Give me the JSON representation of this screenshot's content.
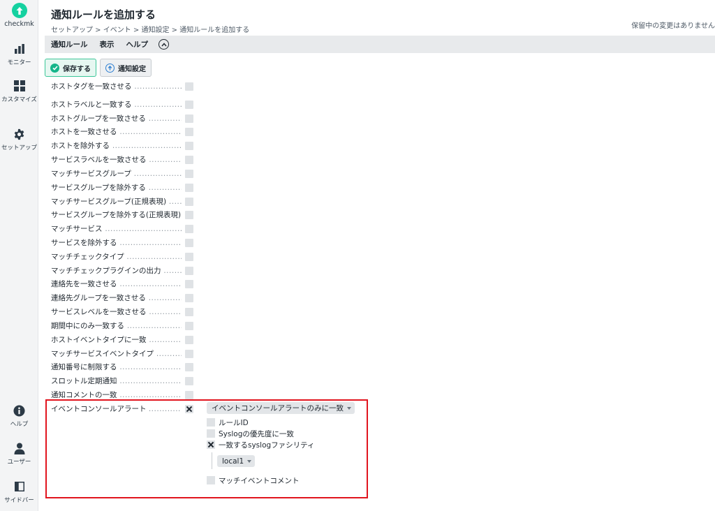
{
  "sidebar": {
    "logo_text": "checkmk",
    "top_items": [
      {
        "label": "モニター",
        "icon": "bar-chart-icon"
      },
      {
        "label": "カスタマイズ",
        "icon": "grid-icon"
      },
      {
        "label": "セットアップ",
        "icon": "gear-icon"
      }
    ],
    "bottom_items": [
      {
        "label": "ヘルプ",
        "icon": "info-icon"
      },
      {
        "label": "ユーザー",
        "icon": "user-icon"
      },
      {
        "label": "サイドバー",
        "icon": "sidebar-toggle-icon"
      }
    ]
  },
  "header": {
    "title": "通知ルールを追加する",
    "breadcrumb": "セットアップ > イベント > 通知設定 > 通知ルールを追加する",
    "pending_changes": "保留中の変更はありません"
  },
  "menubar": {
    "items": [
      "通知ルール",
      "表示",
      "ヘルプ"
    ]
  },
  "toolbar": {
    "save_label": "保存する",
    "settings_label": "通知設定"
  },
  "form": {
    "rows": [
      {
        "label": "ホストタグを一致させる",
        "checked": false
      },
      {
        "label": "ホストラベルと一致する",
        "checked": false
      },
      {
        "label": "ホストグループを一致させる",
        "checked": false
      },
      {
        "label": "ホストを一致させる",
        "checked": false
      },
      {
        "label": "ホストを除外する",
        "checked": false
      },
      {
        "label": "サービスラベルを一致させる",
        "checked": false
      },
      {
        "label": "マッチサービスグループ",
        "checked": false
      },
      {
        "label": "サービスグループを除外する",
        "checked": false
      },
      {
        "label": "マッチサービスグループ(正規表現)",
        "checked": false
      },
      {
        "label": "サービスグループを除外する(正規表現)",
        "checked": false
      },
      {
        "label": "マッチサービス",
        "checked": false
      },
      {
        "label": "サービスを除外する",
        "checked": false
      },
      {
        "label": "マッチチェックタイプ",
        "checked": false
      },
      {
        "label": "マッチチェックプラグインの出力",
        "checked": false
      },
      {
        "label": "連絡先を一致させる",
        "checked": false
      },
      {
        "label": "連絡先グループを一致させる",
        "checked": false
      },
      {
        "label": "サービスレベルを一致させる",
        "checked": false
      },
      {
        "label": "期間中にのみ一致する",
        "checked": false
      },
      {
        "label": "ホストイベントタイプに一致",
        "checked": false
      },
      {
        "label": "マッチサービスイベントタイプ",
        "checked": false
      },
      {
        "label": "通知番号に制限する",
        "checked": false
      },
      {
        "label": "スロットル定期通知",
        "checked": false
      },
      {
        "label": "通知コメントの一致",
        "checked": false
      }
    ],
    "ec": {
      "label": "イベントコンソールアラート",
      "checked": true,
      "mode_select": "イベントコンソールアラートのみに一致",
      "options": [
        {
          "label": "ルールID",
          "checked": false
        },
        {
          "label": "Syslogの優先度に一致",
          "checked": false
        },
        {
          "label": "一致するsyslogファシリティ",
          "checked": true
        }
      ],
      "facility_select": "local1",
      "comment_option": {
        "label": "マッチイベントコメント",
        "checked": false
      }
    }
  },
  "colors": {
    "brand": "#15d1a0",
    "highlight": "#e1141e"
  }
}
